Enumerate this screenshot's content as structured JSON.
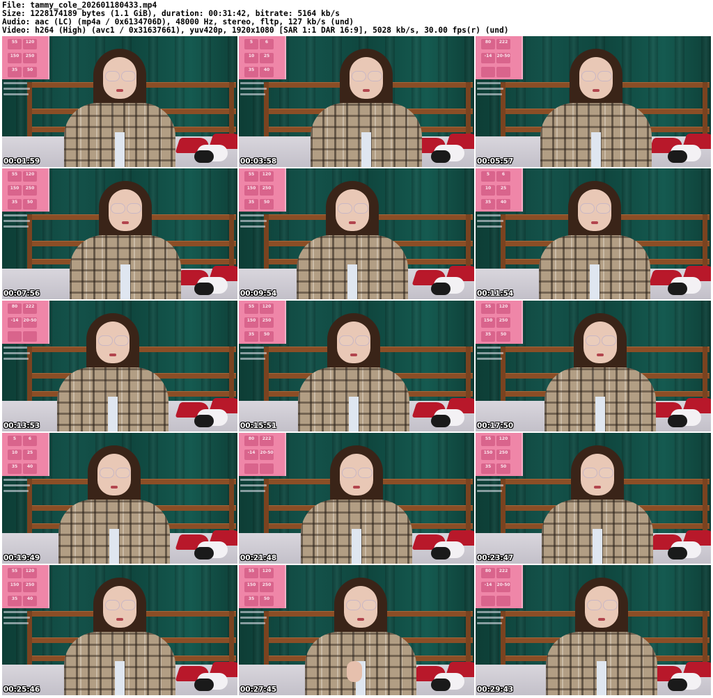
{
  "header": {
    "lines": [
      "File: tammy_cole_202601180433.mp4",
      "Size: 1228174189 bytes (1.1 GiB), duration: 00:31:42, bitrate: 5164 kb/s",
      "Audio: aac (LC) (mp4a / 0x6134706D), 48000 Hz, stereo, fltp, 127 kb/s (und)",
      "Video: h264 (High) (avc1 / 0x31637661), yuv420p, 1920x1080 [SAR 1:1 DAR 16:9], 5028 kb/s, 30.00 fps(r) (und)"
    ]
  },
  "thumbnails": [
    {
      "timestamp": "00:01:59",
      "panel": [
        "55",
        "120",
        "150",
        "250",
        "35",
        "50"
      ]
    },
    {
      "timestamp": "00:03:58",
      "panel": [
        "5",
        "6",
        "10",
        "25",
        "35",
        "40"
      ]
    },
    {
      "timestamp": "00:05:57",
      "panel": [
        "80",
        "222",
        "-14",
        "20-50",
        "",
        ""
      ]
    },
    {
      "timestamp": "00:07:56",
      "panel": [
        "55",
        "120",
        "150",
        "250",
        "35",
        "50"
      ]
    },
    {
      "timestamp": "00:09:54",
      "panel": [
        "55",
        "120",
        "150",
        "250",
        "35",
        "50"
      ]
    },
    {
      "timestamp": "00:11:54",
      "panel": [
        "5",
        "6",
        "10",
        "25",
        "35",
        "40"
      ]
    },
    {
      "timestamp": "00:13:53",
      "panel": [
        "80",
        "222",
        "-14",
        "20-50",
        "",
        ""
      ]
    },
    {
      "timestamp": "00:15:51",
      "panel": [
        "55",
        "120",
        "150",
        "250",
        "35",
        "50"
      ]
    },
    {
      "timestamp": "00:17:50",
      "panel": [
        "55",
        "120",
        "150",
        "250",
        "35",
        "50"
      ]
    },
    {
      "timestamp": "00:19:49",
      "panel": [
        "5",
        "6",
        "10",
        "25",
        "35",
        "40"
      ]
    },
    {
      "timestamp": "00:21:48",
      "panel": [
        "80",
        "222",
        "-14",
        "20-50",
        "",
        ""
      ]
    },
    {
      "timestamp": "00:23:47",
      "panel": [
        "55",
        "120",
        "150",
        "250",
        "35",
        "50"
      ]
    },
    {
      "timestamp": "00:25:46",
      "panel": [
        "55",
        "120",
        "150",
        "250",
        "35",
        "40"
      ]
    },
    {
      "timestamp": "00:27:45",
      "panel": [
        "55",
        "120",
        "150",
        "250",
        "35",
        "50"
      ]
    },
    {
      "timestamp": "00:29:43",
      "panel": [
        "80",
        "222",
        "-14",
        "20-50",
        "",
        ""
      ]
    }
  ]
}
